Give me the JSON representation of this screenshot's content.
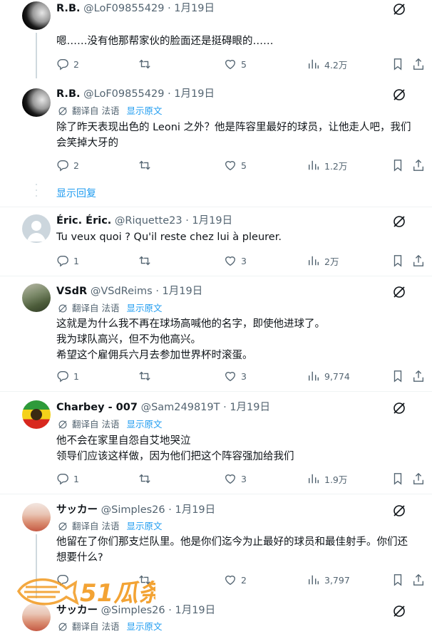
{
  "translate_label": "翻译自 法语",
  "show_original": "显示原文",
  "show_replies": "显示回复",
  "watermark_text": "51瓜条",
  "tweets": [
    {
      "name": "R.B.",
      "handle": "@LoF09855429",
      "date": "1月19日",
      "text": [
        "嗯……没有他那帮家伙的脸面还是挺碍眼的……"
      ],
      "replies": "2",
      "retweets": "",
      "likes": "5",
      "views": "4.2万"
    },
    {
      "name": "R.B.",
      "handle": "@LoF09855429",
      "date": "1月19日",
      "text": [
        "除了昨天表现出色的 Leoni 之外？他是阵容里最好的球员，让他走人吧，我们",
        "会笑掉大牙的"
      ],
      "replies": "2",
      "retweets": "",
      "likes": "5",
      "views": "1.2万"
    },
    {
      "name": "Éric. Éric.",
      "handle": "@Riquette23",
      "date": "1月19日",
      "text": [
        "Tu veux quoi ? Qu'il reste chez lui à pleurer."
      ],
      "replies": "1",
      "retweets": "",
      "likes": "3",
      "views": "2万"
    },
    {
      "name": "VSdR",
      "handle": "@VSdReims",
      "date": "1月19日",
      "text": [
        "这就是为什么我不再在球场高喊他的名字，即使他进球了。",
        "我为球队高兴，但不为他高兴。",
        "希望这个雇佣兵六月去参加世界杯时滚蛋。"
      ],
      "replies": "1",
      "retweets": "",
      "likes": "3",
      "views": "9,774"
    },
    {
      "name": "Charbey - 007",
      "handle": "@Sam249819T",
      "date": "1月19日",
      "text": [
        "他不会在家里自怨自艾地哭泣",
        "领导们应该这样做，因为他们把这个阵容强加给我们"
      ],
      "replies": "1",
      "retweets": "",
      "likes": "3",
      "views": "1.9万"
    },
    {
      "name": "サッカー",
      "handle": "@Simples26",
      "date": "1月19日",
      "text": [
        "他留在了你们那支烂队里。他是你们迄今为止最好的球员和最佳射手。你们还",
        "想要什么?"
      ],
      "replies": "",
      "retweets": "",
      "likes": "2",
      "views": "3,797"
    },
    {
      "name": "サッカー",
      "handle": "@Simples26",
      "date": "1月19日",
      "text": [],
      "replies": "",
      "retweets": "",
      "likes": "",
      "views": ""
    }
  ]
}
